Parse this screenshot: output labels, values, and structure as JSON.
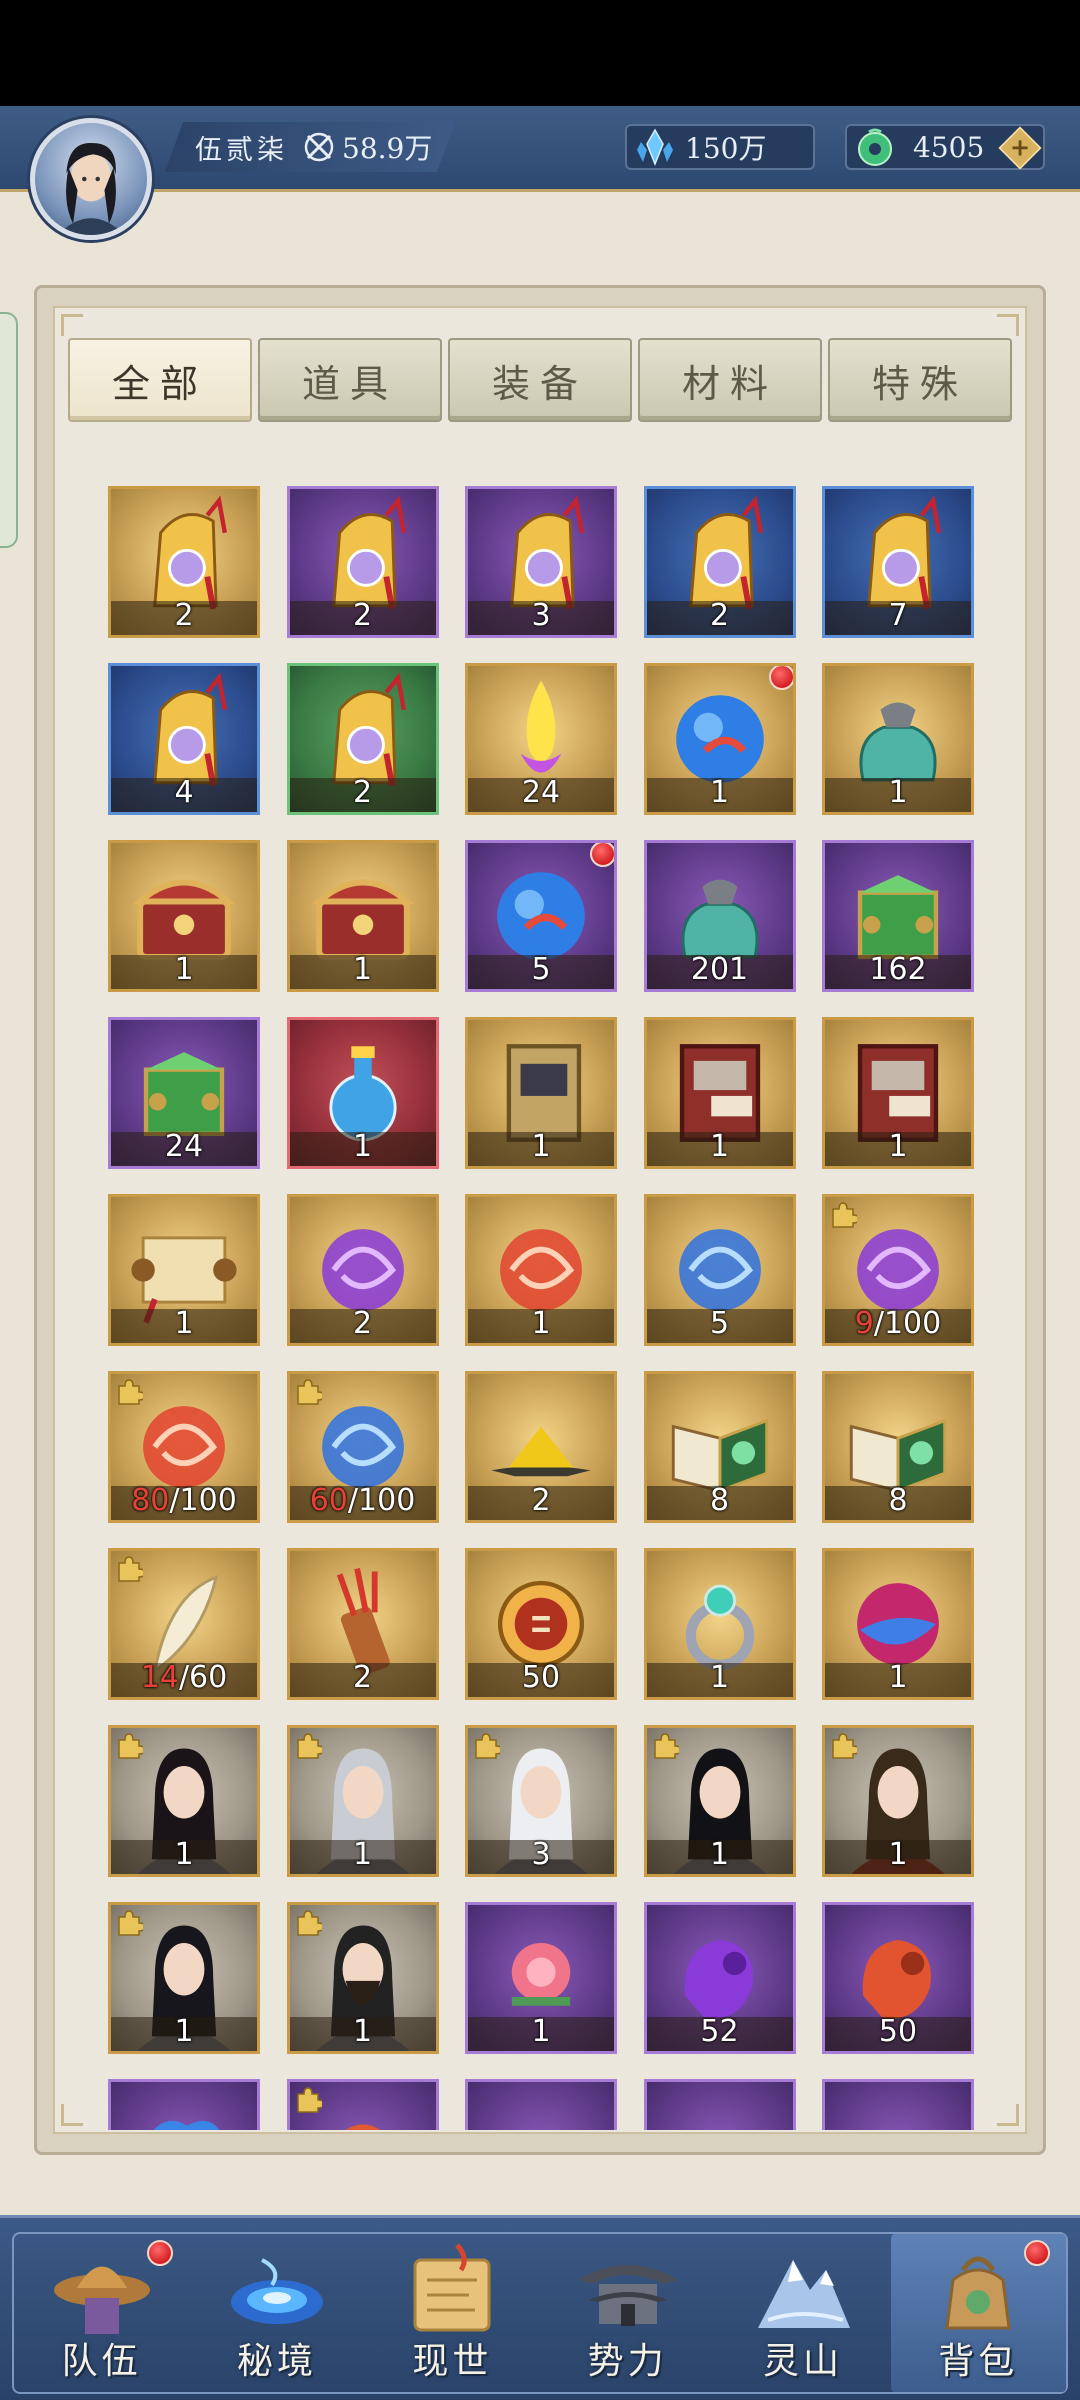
{
  "header": {
    "player_name": "伍贰柒",
    "combat_power": "58.9万",
    "crystal_amount": "150万",
    "jade_amount": "4505",
    "plus_label": "+"
  },
  "tabs": [
    {
      "label": "全部",
      "active": true
    },
    {
      "label": "道具",
      "active": false
    },
    {
      "label": "装备",
      "active": false
    },
    {
      "label": "材料",
      "active": false
    },
    {
      "label": "特殊",
      "active": false
    }
  ],
  "items": [
    {
      "icon": "pouch-gold",
      "quality": "gold",
      "count": "2"
    },
    {
      "icon": "pouch-gold",
      "quality": "purple",
      "count": "2"
    },
    {
      "icon": "pouch-gold",
      "quality": "purple",
      "count": "3"
    },
    {
      "icon": "pouch-gold",
      "quality": "blue",
      "count": "2"
    },
    {
      "icon": "pouch-gold",
      "quality": "blue",
      "count": "7"
    },
    {
      "icon": "pouch-gold",
      "quality": "blue",
      "count": "4"
    },
    {
      "icon": "pouch-gold",
      "quality": "green",
      "count": "2"
    },
    {
      "icon": "crystal-flame",
      "quality": "gold",
      "count": "24"
    },
    {
      "icon": "koi-orb",
      "quality": "gold",
      "count": "1",
      "red_dot": true
    },
    {
      "icon": "teal-sack",
      "quality": "gold",
      "count": "1"
    },
    {
      "icon": "treasure-chest",
      "quality": "gold",
      "count": "1"
    },
    {
      "icon": "treasure-chest",
      "quality": "gold",
      "count": "1"
    },
    {
      "icon": "blue-orb",
      "quality": "purple",
      "count": "5",
      "red_dot": true
    },
    {
      "icon": "teal-sack",
      "quality": "purple",
      "count": "201"
    },
    {
      "icon": "jade-box",
      "quality": "purple",
      "count": "162"
    },
    {
      "icon": "jade-box",
      "quality": "purple",
      "count": "24"
    },
    {
      "icon": "potion-gourd",
      "quality": "red",
      "count": "1"
    },
    {
      "icon": "book-tan",
      "quality": "gold",
      "count": "1"
    },
    {
      "icon": "book-red",
      "quality": "gold",
      "count": "1"
    },
    {
      "icon": "book-red",
      "quality": "gold",
      "count": "1"
    },
    {
      "icon": "scroll",
      "quality": "gold",
      "count": "1"
    },
    {
      "icon": "swirl-purple",
      "quality": "gold",
      "count": "2"
    },
    {
      "icon": "swirl-red",
      "quality": "gold",
      "count": "1"
    },
    {
      "icon": "swirl-blue",
      "quality": "gold",
      "count": "5"
    },
    {
      "icon": "swirl-purple",
      "quality": "gold",
      "fragment": true,
      "have": "9",
      "need": "/100"
    },
    {
      "icon": "swirl-red",
      "quality": "gold",
      "fragment": true,
      "have": "80",
      "need": "/100"
    },
    {
      "icon": "swirl-blue",
      "quality": "gold",
      "fragment": true,
      "have": "60",
      "need": "/100"
    },
    {
      "icon": "sand-pile",
      "quality": "gold",
      "count": "2"
    },
    {
      "icon": "book-open-green",
      "quality": "gold",
      "count": "8"
    },
    {
      "icon": "book-open-green",
      "quality": "gold",
      "count": "8"
    },
    {
      "icon": "feather-blade",
      "quality": "gold",
      "fragment": true,
      "have": "14",
      "need": "/60"
    },
    {
      "icon": "arrow-quiver",
      "quality": "gold",
      "count": "2"
    },
    {
      "icon": "medallion",
      "quality": "gold",
      "count": "50"
    },
    {
      "icon": "jade-ring",
      "quality": "gold",
      "count": "1"
    },
    {
      "icon": "dual-orb",
      "quality": "gold",
      "count": "1"
    },
    {
      "icon": "portrait-girl-dark-hair",
      "quality": "grey",
      "fragment": true,
      "count": "1"
    },
    {
      "icon": "portrait-man-silver-hair",
      "quality": "grey",
      "fragment": true,
      "count": "1"
    },
    {
      "icon": "portrait-woman-white-hair",
      "quality": "grey",
      "fragment": true,
      "count": "3"
    },
    {
      "icon": "portrait-woman-black-hair",
      "quality": "grey",
      "fragment": true,
      "count": "1"
    },
    {
      "icon": "portrait-warrior",
      "quality": "grey",
      "fragment": true,
      "count": "1"
    },
    {
      "icon": "portrait-swordsman",
      "quality": "grey",
      "fragment": true,
      "count": "1"
    },
    {
      "icon": "portrait-bearded-man",
      "quality": "grey",
      "fragment": true,
      "count": "1"
    },
    {
      "icon": "peony-flower",
      "quality": "purple",
      "count": "1"
    },
    {
      "icon": "spirit-stone-purple",
      "quality": "purple",
      "count": "52"
    },
    {
      "icon": "spirit-stone-orange",
      "quality": "purple",
      "count": "50"
    },
    {
      "icon": "cloud-orb",
      "quality": "purple",
      "count": ""
    },
    {
      "icon": "fire-orb",
      "quality": "purple",
      "fragment": true,
      "count": ""
    },
    {
      "icon": "unknown",
      "quality": "purple",
      "count": ""
    },
    {
      "icon": "unknown",
      "quality": "purple",
      "count": ""
    },
    {
      "icon": "unknown",
      "quality": "purple",
      "count": ""
    }
  ],
  "nav": [
    {
      "label": "队伍",
      "icon": "team-hat-icon",
      "red_dot": true,
      "active": false
    },
    {
      "label": "秘境",
      "icon": "vortex-icon",
      "red_dot": false,
      "active": false
    },
    {
      "label": "现世",
      "icon": "scroll-map-icon",
      "red_dot": false,
      "active": false
    },
    {
      "label": "势力",
      "icon": "pavilion-icon",
      "red_dot": false,
      "active": false
    },
    {
      "label": "灵山",
      "icon": "mountain-icon",
      "red_dot": false,
      "active": false
    },
    {
      "label": "背包",
      "icon": "backpack-icon",
      "red_dot": true,
      "active": true
    }
  ],
  "colors": {
    "header_bg": "#3f5d86",
    "panel_bg": "#ebe7dc",
    "badge_red": "#d41f23",
    "have_red": "#e8413a"
  }
}
